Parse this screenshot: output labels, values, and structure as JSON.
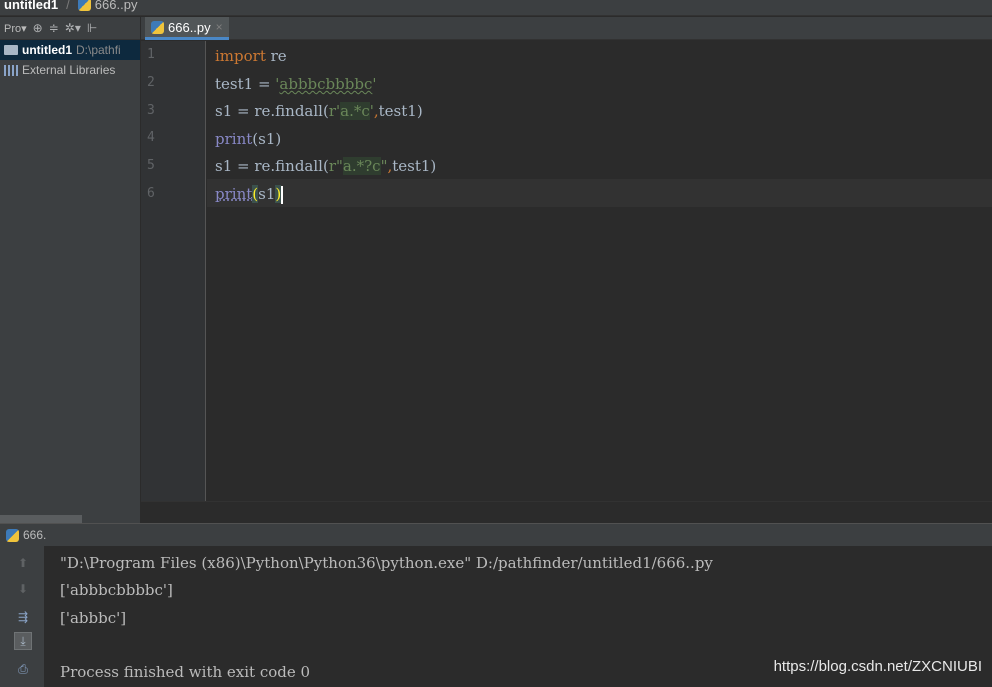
{
  "breadcrumb": {
    "project": "untitled1",
    "file": "666..py"
  },
  "project_panel": {
    "toolbar_label": "Pro",
    "root_name": "untitled1",
    "root_path": "D:\\pathfi",
    "libraries": "External Libraries"
  },
  "editor": {
    "tab_label": "666..py",
    "line_numbers": [
      "1",
      "2",
      "3",
      "4",
      "5",
      "6"
    ],
    "lines": {
      "l1": {
        "kw": "import",
        "rest": " re"
      },
      "l2": {
        "a": "test1 = ",
        "q1": "'",
        "str": "abbbcbbbbc",
        "q2": "'"
      },
      "l3": {
        "a": "s1 = re.findall(",
        "pre": "r'",
        "rx": "a.*c",
        "q": "'",
        "comma": ",",
        "b": "test1)"
      },
      "l4": {
        "bi": "print",
        "b": "(s1)"
      },
      "l5": {
        "a": "s1 = re.findall(",
        "pre": "r\"",
        "rx": "a.*?c",
        "q": "\"",
        "comma": ",",
        "b": "test1)"
      },
      "l6": {
        "bi": "print",
        "open": "(",
        "arg": "s1",
        "close": ")"
      }
    }
  },
  "run": {
    "tab_label": "666.",
    "output": [
      "\"D:\\Program Files (x86)\\Python\\Python36\\python.exe\" D:/pathfinder/untitled1/666..py",
      "['abbbcbbbbc']",
      "['abbbc']",
      "Process finished with exit code 0"
    ]
  },
  "watermark": "https://blog.csdn.net/ZXCNIUBI",
  "icons": [
    "python-file-icon",
    "folder-icon",
    "library-icon",
    "gear-icon",
    "collapse-icon",
    "close-icon",
    "up-arrow-icon",
    "down-arrow-icon",
    "soft-wrap-icon",
    "scroll-to-end-icon",
    "print-icon"
  ],
  "colors": {
    "keyword": "#cc7832",
    "builtin": "#8888c6",
    "string": "#6a8759",
    "text": "#a9b7c6",
    "background": "#2b2b2b"
  }
}
